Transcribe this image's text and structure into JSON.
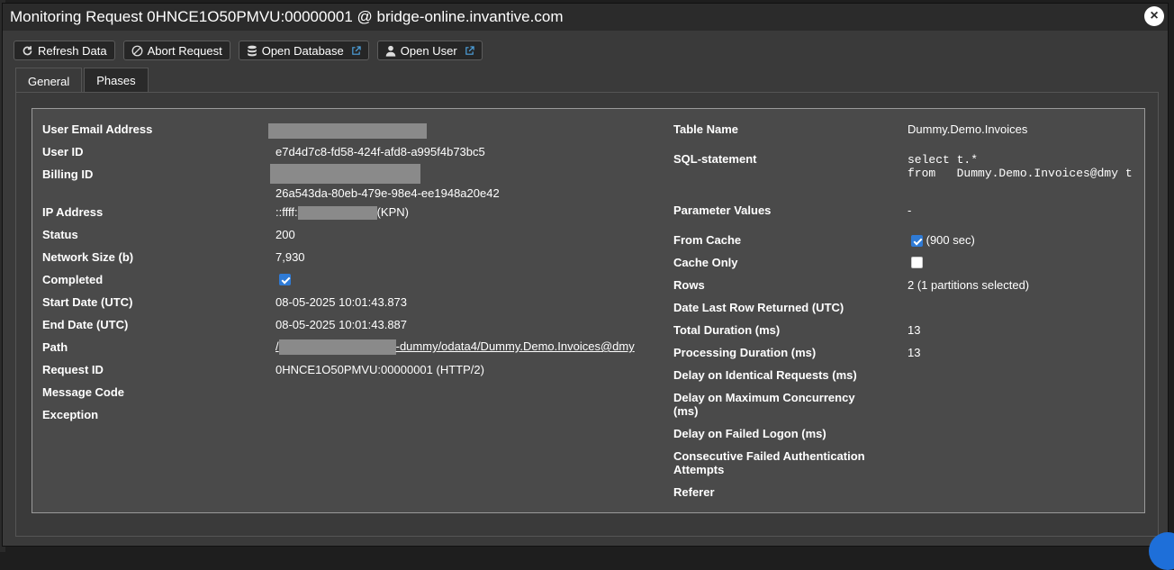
{
  "dialog": {
    "title": "Monitoring Request 0HNCE1O50PMVU:00000001 @ bridge-online.invantive.com",
    "close_icon": "×"
  },
  "toolbar": {
    "refresh": "Refresh Data",
    "abort": "Abort Request",
    "open_database": "Open Database",
    "open_user": "Open User"
  },
  "tabs": {
    "general": "General",
    "phases": "Phases"
  },
  "left": {
    "user_email": {
      "label": "User Email Address",
      "value": ""
    },
    "user_id": {
      "label": "User ID",
      "value": "e7d4d7c8-fd58-424f-afd8-a995f4b73bc5"
    },
    "billing_id": {
      "label": "Billing ID",
      "value": "26a543da-80eb-479e-98e4-ee1948a20e42"
    },
    "ip_address": {
      "label": "IP Address",
      "prefix": "::ffff:",
      "suffix": "(KPN)"
    },
    "status": {
      "label": "Status",
      "value": "200"
    },
    "network_size": {
      "label": "Network Size (b)",
      "value": "7,930"
    },
    "completed": {
      "label": "Completed",
      "checked": true
    },
    "start_date": {
      "label": "Start Date (UTC)",
      "value": "08-05-2025 10:01:43.873"
    },
    "end_date": {
      "label": "End Date (UTC)",
      "value": "08-05-2025 10:01:43.887"
    },
    "path": {
      "label": "Path",
      "prefix": "/",
      "suffix": "-dummy/odata4/Dummy.Demo.Invoices@dmy"
    },
    "request_id": {
      "label": "Request ID",
      "value": "0HNCE1O50PMVU:00000001 (HTTP/2)"
    },
    "message_code": {
      "label": "Message Code",
      "value": ""
    },
    "exception": {
      "label": "Exception",
      "value": ""
    }
  },
  "right": {
    "table_name": {
      "label": "Table Name",
      "value": "Dummy.Demo.Invoices"
    },
    "sql_statement": {
      "label": "SQL-statement",
      "line1": "select t.*",
      "line2": "from   Dummy.Demo.Invoices@dmy t"
    },
    "parameter_values": {
      "label": "Parameter Values",
      "value": "-"
    },
    "from_cache": {
      "label": "From Cache",
      "checked": true,
      "value": "(900 sec)"
    },
    "cache_only": {
      "label": "Cache Only",
      "checked": false
    },
    "rows": {
      "label": "Rows",
      "value": "2 (1 partitions selected)"
    },
    "date_last_row": {
      "label": "Date Last Row Returned (UTC)",
      "value": ""
    },
    "total_duration": {
      "label": "Total Duration (ms)",
      "value": "13"
    },
    "processing_duration": {
      "label": "Processing Duration (ms)",
      "value": "13"
    },
    "delay_identical": {
      "label": "Delay on Identical Requests (ms)",
      "value": ""
    },
    "delay_concurrency": {
      "label1": "Delay on Maximum Concurrency",
      "label2": "(ms)",
      "value": ""
    },
    "delay_failed_logon": {
      "label": "Delay on Failed Logon (ms)",
      "value": ""
    },
    "consecutive_failed": {
      "label1": "Consecutive Failed Authentication",
      "label2": "Attempts",
      "value": ""
    },
    "referer": {
      "label": "Referer",
      "value": ""
    }
  },
  "colors": {
    "dialog_bg": "#3a3a3a",
    "panel_bg": "#4a4a4a",
    "accent": "#2f7bd6",
    "link_icon": "#4ea3e0"
  }
}
